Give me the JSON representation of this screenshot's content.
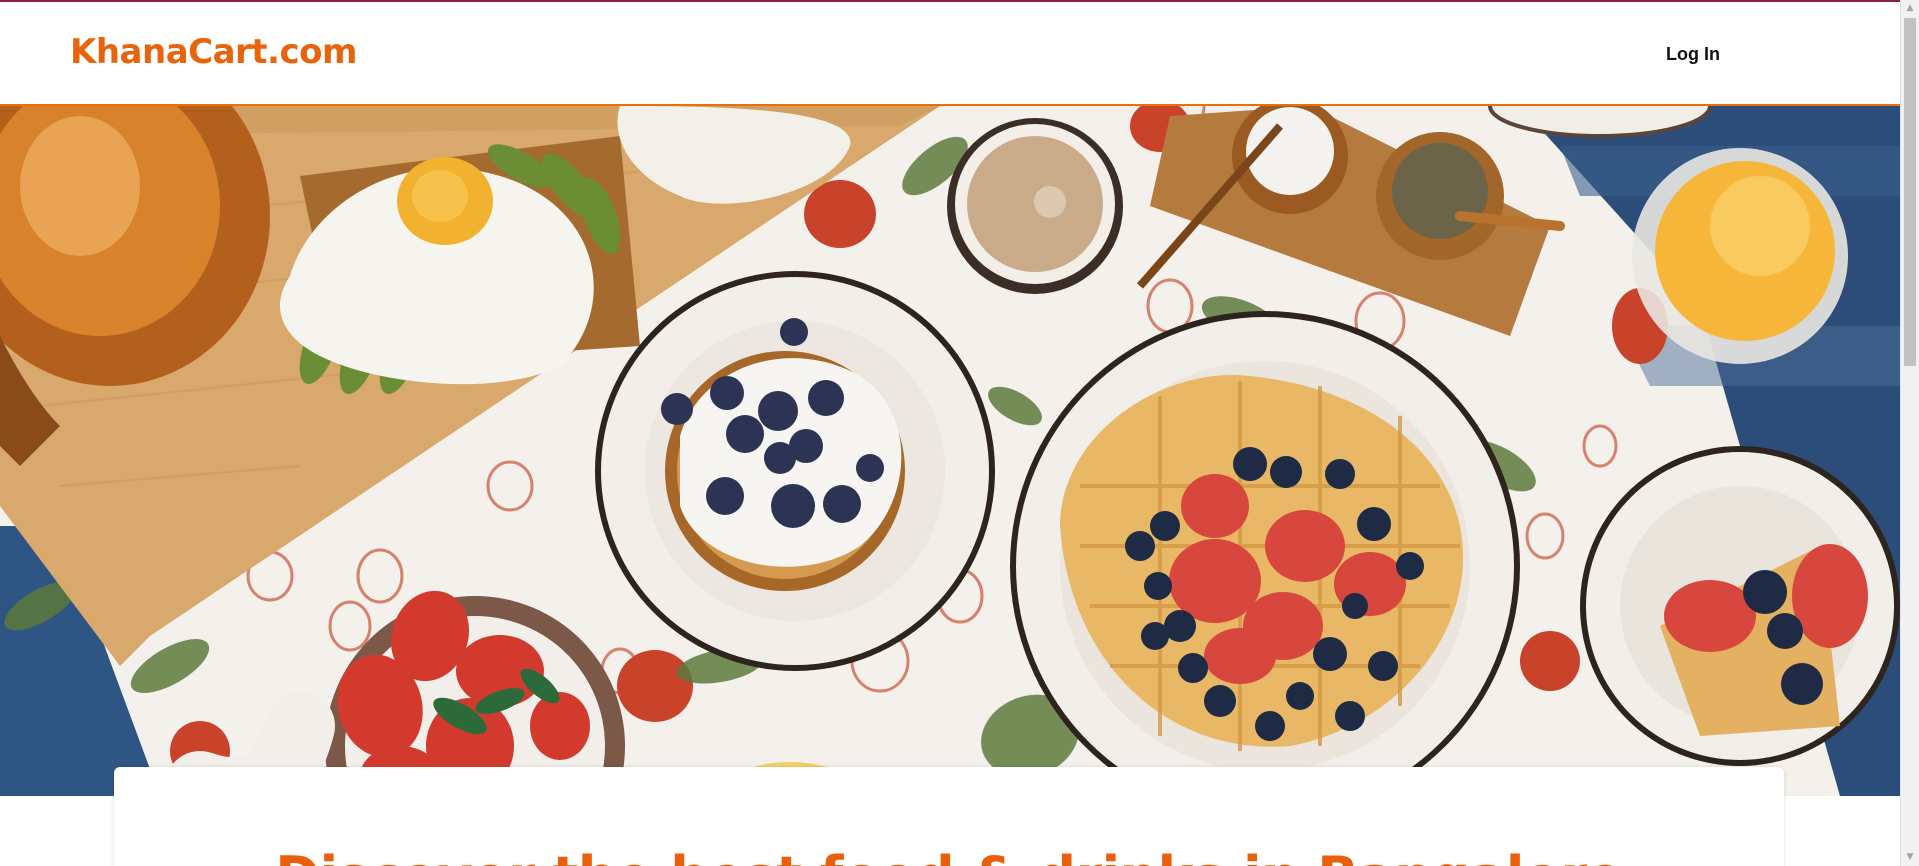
{
  "header": {
    "logo_text": "KhanaCart.com",
    "login_label": "Log In"
  },
  "hero": {
    "image_description_icon": "breakfast-table-photo",
    "headline": "Discover the best food & drinks in Bangalore"
  },
  "colors": {
    "brand": "#e8640c",
    "top_accent": "#8b1c4a",
    "text_dark": "#111111"
  },
  "scrollbar": {
    "up_icon": "scroll-up-arrow",
    "down_icon": "scroll-down-arrow"
  }
}
